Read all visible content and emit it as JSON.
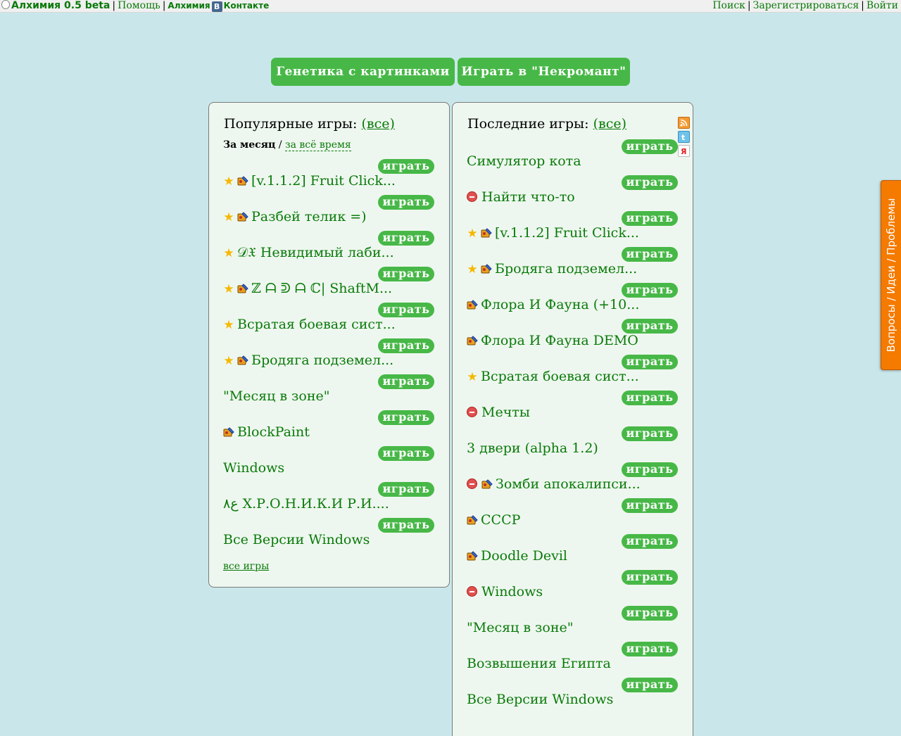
{
  "topbar": {
    "brand": "Алхимия 0.5 beta",
    "help": "Помощь",
    "vk_prefix": "Алхимия",
    "vk_logo": "В",
    "vk_suffix": "Контакте",
    "search": "Поиск",
    "register": "Зарегистрироваться",
    "login": "Войти"
  },
  "promo": {
    "genetics": "Генетика с картинками",
    "necromant": "Играть в \"Некромант\""
  },
  "play_label": "играть",
  "popular": {
    "title": "Популярные игры:",
    "all_link": "(все)",
    "period_current": "За месяц",
    "period_sep": "/",
    "period_alltime": "за всё время",
    "all_games_link": "все игры",
    "games": [
      {
        "title": "[v.1.1.2] Fruit Click...",
        "icons": [
          "star-icon",
          "paint-icon"
        ]
      },
      {
        "title": "Разбей телик =)",
        "icons": [
          "star-icon",
          "paint-icon"
        ]
      },
      {
        "title": "𝒟𝔛 Невидимый лаби...",
        "icons": [
          "star-icon"
        ]
      },
      {
        "title": "ℤ ᗩ ᕲ ᗩ ℂ| ShaftM...",
        "icons": [
          "star-icon",
          "paint-icon"
        ]
      },
      {
        "title": "Всратая боевая сист...",
        "icons": [
          "star-icon"
        ]
      },
      {
        "title": "Бродяга подземел...",
        "icons": [
          "star-icon",
          "paint-icon"
        ]
      },
      {
        "title": "\"Месяц в зоне\"",
        "icons": []
      },
      {
        "title": "BlockPaint",
        "icons": [
          "paint-icon"
        ]
      },
      {
        "title": "Windows",
        "icons": []
      },
      {
        "title": "ع٨ Х.Р.О.Н.И.К.И Р.И....",
        "icons": []
      },
      {
        "title": "Все Версии Windows",
        "icons": []
      }
    ]
  },
  "recent": {
    "title": "Последние игры:",
    "all_link": "(все)",
    "games": [
      {
        "title": "Симулятор кота",
        "icons": []
      },
      {
        "title": "Найти что-то",
        "icons": [
          "stop-icon"
        ]
      },
      {
        "title": "[v.1.1.2] Fruit Click...",
        "icons": [
          "star-icon",
          "paint-icon"
        ]
      },
      {
        "title": "Бродяга подземел...",
        "icons": [
          "star-icon",
          "paint-icon"
        ]
      },
      {
        "title": "Флора И Фауна (+10...",
        "icons": [
          "paint-icon"
        ]
      },
      {
        "title": "Флора И Фауна DEMO",
        "icons": [
          "paint-icon"
        ]
      },
      {
        "title": "Всратая боевая сист...",
        "icons": [
          "star-icon"
        ]
      },
      {
        "title": "Мечты",
        "icons": [
          "stop-icon"
        ]
      },
      {
        "title": "3 двери (alpha 1.2)",
        "icons": []
      },
      {
        "title": "Зомби апокалипси...",
        "icons": [
          "stop-icon",
          "paint-icon"
        ]
      },
      {
        "title": "СССР",
        "icons": [
          "paint-icon"
        ]
      },
      {
        "title": "Doodle Devil",
        "icons": [
          "paint-icon"
        ]
      },
      {
        "title": "Windows",
        "icons": [
          "stop-icon"
        ]
      },
      {
        "title": "\"Месяц в зоне\"",
        "icons": []
      },
      {
        "title": "Возвышения Египта",
        "icons": []
      },
      {
        "title": "Все Версии Windows",
        "icons": []
      }
    ]
  },
  "side_icons": [
    "rss-icon",
    "twitter-icon",
    "yandex-icon"
  ],
  "feedback_tab": "Вопросы / Идеи / Проблемы",
  "colors": {
    "background": "#c9e7ea",
    "accent_green": "#47b847",
    "link_green": "#0a7a0a",
    "panel_bg": "#eef7ef",
    "feedback_orange": "#f47a00"
  }
}
